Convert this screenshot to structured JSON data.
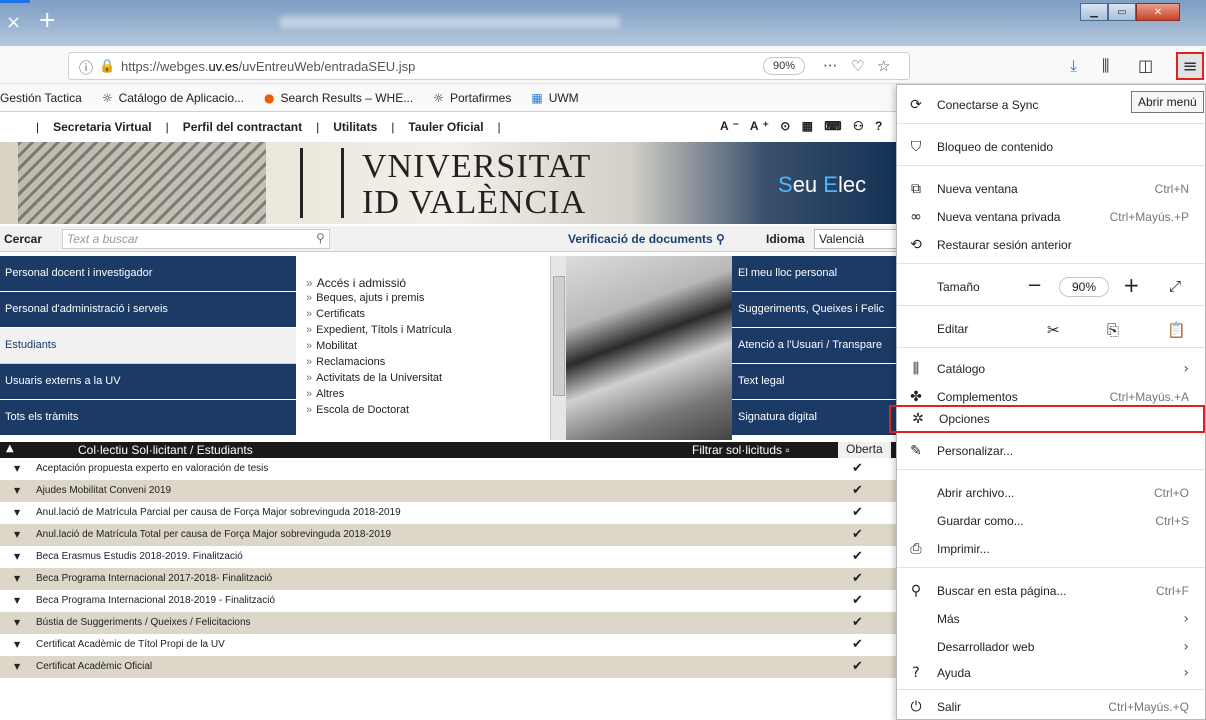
{
  "browser": {
    "tab_close": "×",
    "tab_new": "+",
    "url_base": "https://webges.",
    "url_domain": "uv.es",
    "url_path": "/uvEntreuWeb/entradaSEU.jsp",
    "zoom": "90%"
  },
  "bookmarks": [
    {
      "label": "Gestión Tactica",
      "icon": "bookmark-icon"
    },
    {
      "label": "Catálogo de Aplicacio...",
      "icon": "app-icon"
    },
    {
      "label": "Search Results – WHE...",
      "icon": "firefox-icon"
    },
    {
      "label": "Portafirmes",
      "icon": "app-icon"
    },
    {
      "label": "UWM",
      "icon": "folder-icon"
    }
  ],
  "site": {
    "topnav": [
      "Secretaria Virtual",
      "Perfil del contractant",
      "Utilitats",
      "Tauler Oficial"
    ],
    "topnav_tools": "A⁻ A⁺ ⊙ ▦ ⌨ ⚇ ?",
    "logo_line1": "VNIVERSITAT",
    "logo_line2": "ID VALÈNCIA",
    "seu_s": "S",
    "seu_text": "eu ",
    "seu_e": "E",
    "seu_rest": "lec",
    "search_label": "Cercar",
    "search_placeholder": "Text a buscar",
    "verif_label": "Verificació de documents",
    "idioma_label": "Idioma",
    "idioma_value": "Valencià",
    "left_menu": [
      "Personal docent i investigador",
      "Personal d'administració i serveis",
      "Estudiants",
      "Usuaris externs a la UV",
      "Tots els tràmits"
    ],
    "sub_menu": [
      "Accés i admissió",
      "Beques, ajuts i premis",
      "Certificats",
      "Expedient, Títols i Matrícula",
      "Mobilitat",
      "Reclamacions",
      "Activitats de la Universitat",
      "Altres",
      "Escola de Doctorat"
    ],
    "right_menu": [
      "El meu lloc personal",
      "Suggeriments, Queixes i Felic",
      "Atenció a l'Usuari / Transpare",
      "Text legal",
      "Signatura digital"
    ],
    "table_title": "Col·lectiu Sol·licitant / Estudiants",
    "table_filter": "Filtrar sol·licituds",
    "table_obert": "Oberta",
    "rows": [
      "Aceptación propuesta experto en valoración de tesis",
      "Ajudes Mobilitat Conveni 2019",
      "Anul.lació de Matrícula Parcial per causa de Força Major sobrevinguda 2018-2019",
      "Anul.lació de Matrícula Total per causa de Força Major sobrevinguda 2018-2019",
      "Beca Erasmus Estudis 2018-2019. Finalització",
      "Beca Programa Internacional 2017-2018- Finalització",
      "Beca Programa Internacional 2018-2019 - Finalització",
      "Bústia de Suggeriments / Queixes / Felicitacions",
      "Certificat Acadèmic de Títol Propi de la UV",
      "Certificat Acadèmic Oficial"
    ]
  },
  "app_menu": {
    "tooltip": "Abrir menú",
    "sync": "Conectarse a Sync",
    "content_blocking": "Bloqueo de contenido",
    "new_window": "Nueva ventana",
    "new_window_sc": "Ctrl+N",
    "private_window": "Nueva ventana privada",
    "private_window_sc": "Ctrl+Mayús.+P",
    "restore": "Restaurar sesión anterior",
    "size": "Tamaño",
    "size_value": "90%",
    "edit": "Editar",
    "catalog": "Catálogo",
    "addons": "Complementos",
    "addons_sc": "Ctrl+Mayús.+A",
    "options": "Opciones",
    "customize": "Personalizar...",
    "open_file": "Abrir archivo...",
    "open_file_sc": "Ctrl+O",
    "save_as": "Guardar como...",
    "save_as_sc": "Ctrl+S",
    "print": "Imprimir...",
    "find": "Buscar en esta página...",
    "find_sc": "Ctrl+F",
    "more": "Más",
    "web_dev": "Desarrollador web",
    "help": "Ayuda",
    "quit": "Salir",
    "quit_sc": "Ctrl+Mayús.+Q"
  }
}
